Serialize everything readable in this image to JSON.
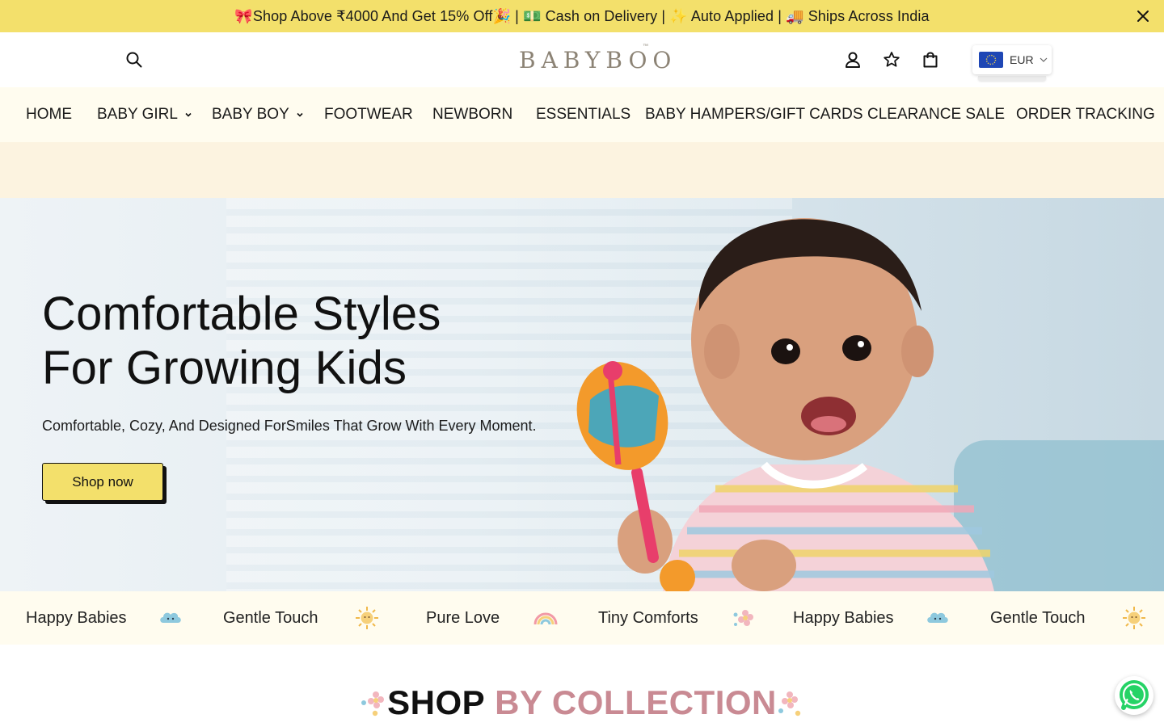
{
  "announcement": {
    "text": "🎀Shop Above ₹4000 And Get 15% Off🎉 | 💵 Cash on Delivery | ✨ Auto Applied | 🚚 Ships Across India",
    "close_icon": "close-icon"
  },
  "header": {
    "logo_text": "BABYBOO",
    "logo_tm": "™",
    "icons": [
      "search-icon",
      "account-icon",
      "wishlist-star-icon",
      "cart-bag-icon"
    ],
    "currency": {
      "code": "EUR",
      "flag": "eu-flag-icon"
    }
  },
  "nav": {
    "items": [
      {
        "label": "HOME",
        "has_dropdown": false
      },
      {
        "label": "BABY GIRL",
        "has_dropdown": true
      },
      {
        "label": "BABY BOY",
        "has_dropdown": true
      },
      {
        "label": "FOOTWEAR",
        "has_dropdown": false
      },
      {
        "label": "NEWBORN",
        "has_dropdown": false
      },
      {
        "label": "ESSENTIALS",
        "has_dropdown": false
      },
      {
        "label": "BABY HAMPERS/GIFT CARDS",
        "has_dropdown": false
      },
      {
        "label": "CLEARANCE SALE",
        "has_dropdown": false
      },
      {
        "label": "ORDER TRACKING",
        "has_dropdown": false
      }
    ]
  },
  "hero": {
    "title_line1": "Comfortable Styles",
    "title_line2": "For Growing Kids",
    "subtitle": "Comfortable, Cozy, And Designed ForSmiles That Grow With Every Moment.",
    "cta_label": "Shop now"
  },
  "ticker": {
    "items": [
      {
        "text": "Happy Babies",
        "icon": "cloud-icon"
      },
      {
        "text": "Gentle Touch",
        "icon": "sun-icon"
      },
      {
        "text": "Pure Love",
        "icon": "rainbow-icon"
      },
      {
        "text": "Tiny Comforts",
        "icon": "flower-icon"
      },
      {
        "text": "Happy Babies",
        "icon": "cloud-icon"
      },
      {
        "text": "Gentle Touch",
        "icon": "sun-icon"
      }
    ]
  },
  "section": {
    "title_dark": "SHOP",
    "title_accent": "BY COLLECTION"
  },
  "colors": {
    "announcement_bg": "#f3e06b",
    "nav_bg": "#fffcef",
    "band_bg": "#fcf3e0",
    "accent_pink": "#c98a93",
    "cta_bg": "#f3e06b",
    "whatsapp": "#25d366"
  }
}
